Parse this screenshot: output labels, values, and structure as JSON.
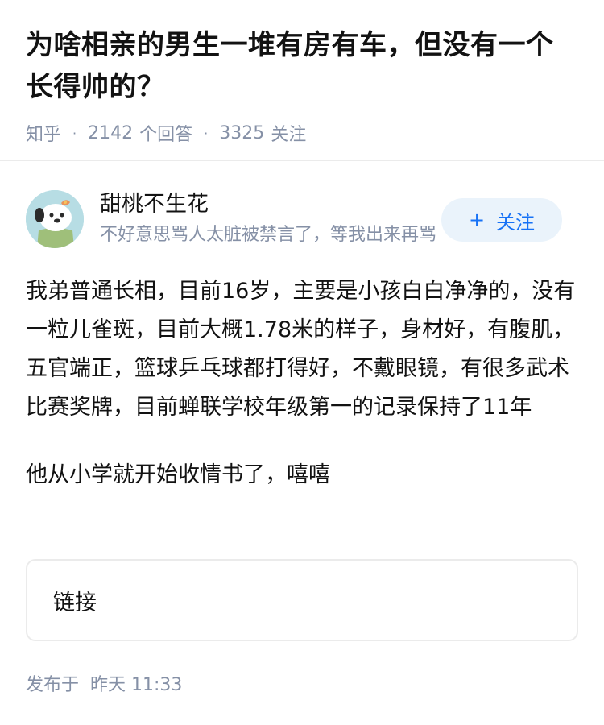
{
  "question": {
    "title": "为啥相亲的男生一堆有房有车，但没有一个长得帅的？",
    "source": "知乎",
    "answer_count": "2142",
    "answer_label": "个回答",
    "follow_count": "3325",
    "follow_label": "关注"
  },
  "author": {
    "name": "甜桃不生花",
    "bio": "不好意思骂人太脏被禁言了，等我出来再骂",
    "follow_button": "关注",
    "avatar_icon": "cartoon-dog-avatar"
  },
  "answer": {
    "paragraphs": [
      "我弟普通长相，目前16岁，主要是小孩白白净净的，没有一粒儿雀斑，目前大概1.78米的样子，身材好，有腹肌，五官端正，篮球乒乓球都打得好，不戴眼镜，有很多武术比赛奖牌，目前蝉联学校年级第一的记录保持了11年",
      "他从小学就开始收情书了，嘻嘻"
    ],
    "link_label": "链接",
    "published_label": "发布于",
    "published_time": "昨天 11:33"
  },
  "colors": {
    "accent": "#1772f6",
    "meta_gray": "#8590a6",
    "follow_bg": "#eaf3fb"
  }
}
